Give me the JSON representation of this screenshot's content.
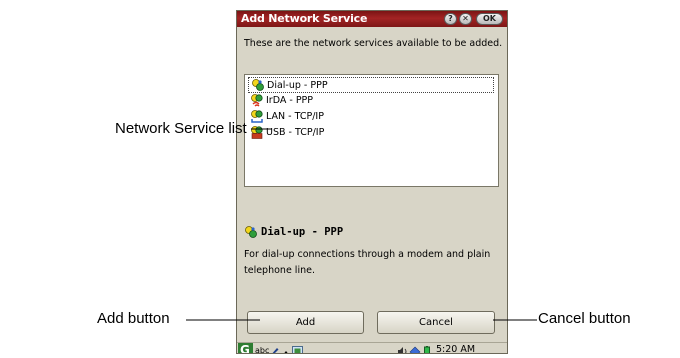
{
  "window": {
    "title": "Add Network Service",
    "help_label": "?",
    "close_label": "✕",
    "ok_label": "OK"
  },
  "intro_text": "These are the network services available to be added.",
  "service_list": {
    "items": [
      {
        "label": "Dial-up - PPP",
        "icon": "dialup-icon",
        "selected": true
      },
      {
        "label": "IrDA - PPP",
        "icon": "irda-icon",
        "selected": false
      },
      {
        "label": "LAN - TCP/IP",
        "icon": "lan-icon",
        "selected": false
      },
      {
        "label": "USB - TCP/IP",
        "icon": "usb-icon",
        "selected": false
      }
    ]
  },
  "detail": {
    "title": "Dial-up - PPP",
    "description": "For dial-up connections through a modem and plain telephone line."
  },
  "buttons": {
    "add_label": "Add",
    "cancel_label": "Cancel"
  },
  "taskbar": {
    "input_label": "abc",
    "clock": "5:20 AM"
  },
  "callouts": {
    "list": "Network Service list",
    "add": "Add button",
    "cancel": "Cancel button"
  },
  "colors": {
    "titlebar": "#8b1a1a",
    "dialog_bg": "#d8d5c7",
    "list_bg": "#ffffff"
  }
}
